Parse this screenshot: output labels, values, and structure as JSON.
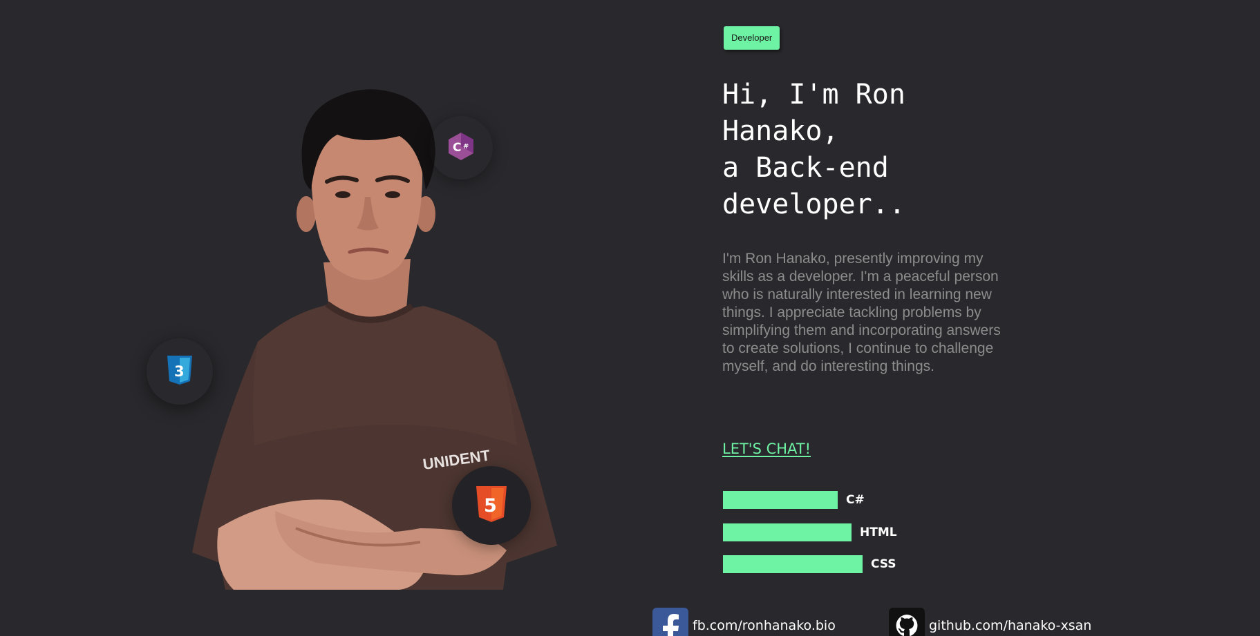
{
  "colors": {
    "background": "#29282c",
    "accent": "#6ef2a3",
    "text": "#ffffff",
    "muted_text": "#8c8c8c",
    "facebook": "#3b5998",
    "github": "#111111"
  },
  "hero": {
    "badge": "Developer",
    "headline_lines": [
      "Hi, I'm Ron",
      "Hanako,",
      "a Back-end",
      "developer.."
    ],
    "bio": "I'm Ron Hanako, presently improving my skills as a developer. I'm a peaceful person who is naturally interested in learning new things. I appreciate tackling problems by simplifying them and incorporating answers to create solutions, I continue to challenge myself, and do interesting things.",
    "cta": "LET'S CHAT!"
  },
  "floating_icons": [
    "csharp-icon",
    "css3-icon",
    "html5-icon"
  ],
  "skills": [
    {
      "name": "C#",
      "level": 0.74
    },
    {
      "name": "HTML",
      "level": 0.83
    },
    {
      "name": "CSS",
      "level": 0.9
    }
  ],
  "social": [
    {
      "icon": "facebook-icon",
      "text": "fb.com/ronhanako.bio"
    },
    {
      "icon": "github-icon",
      "text": "github.com/hanako-xsan"
    }
  ]
}
